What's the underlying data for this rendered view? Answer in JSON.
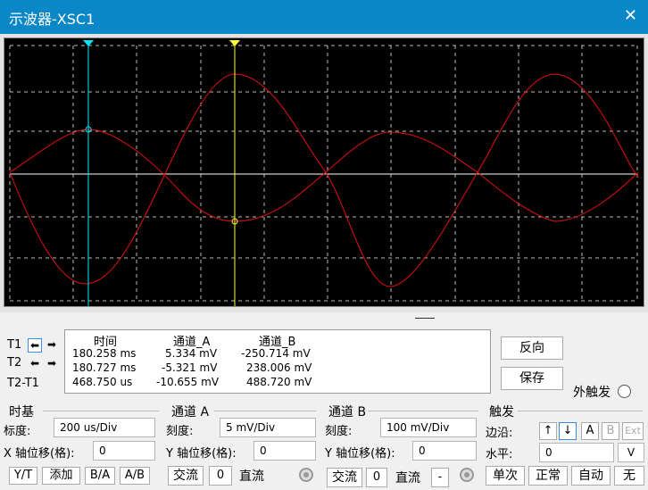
{
  "window": {
    "title": "示波器-XSC1",
    "close_glyph": "✕"
  },
  "cursors": {
    "t1_label": "T1",
    "t2_label": "T2",
    "diff_label": "T2-T1",
    "t1_color": "#00e5ff",
    "t2_color": "#ffff33"
  },
  "readout": {
    "headers": {
      "time": "时间",
      "ch_a": "通道_A",
      "ch_b": "通道_B"
    },
    "rows": [
      {
        "time": "180.258 ms",
        "ch_a": "5.334 mV",
        "ch_b": "-250.714 mV"
      },
      {
        "time": "180.727 ms",
        "ch_a": "-5.321 mV",
        "ch_b": "238.006 mV"
      },
      {
        "time": "468.750 us",
        "ch_a": "-10.655 mV",
        "ch_b": "488.720 mV"
      }
    ]
  },
  "actions": {
    "reverse": "反向",
    "save": "保存",
    "ext_trigger": "外触发"
  },
  "timebase": {
    "title": "时基",
    "scale_label": "标度:",
    "scale_value": "200 us/Div",
    "xpos_label": "X 轴位移(格):",
    "xpos_value": "0",
    "buttons": [
      "Y/T",
      "添加",
      "B/A",
      "A/B"
    ]
  },
  "channel_a": {
    "title": "通道 A",
    "scale_label": "刻度:",
    "scale_value": "5 mV/Div",
    "ypos_label": "Y 轴位移(格):",
    "ypos_value": "0",
    "ac": "交流",
    "zero": "0",
    "dc": "直流"
  },
  "channel_b": {
    "title": "通道 B",
    "scale_label": "刻度:",
    "scale_value": "100 mV/Div",
    "ypos_label": "Y 轴位移(格):",
    "ypos_value": "0",
    "ac": "交流",
    "zero": "0",
    "dc": "直流",
    "minus": "-"
  },
  "trigger": {
    "title": "触发",
    "edge_label": "边沿:",
    "edge_rise": "↑",
    "edge_fall": "↓",
    "src_a": "A",
    "src_b": "B",
    "src_ext": "Ext",
    "level_label": "水平:",
    "level_value": "0",
    "level_unit": "V",
    "modes": [
      "单次",
      "正常",
      "自动",
      "无"
    ]
  },
  "colors": {
    "trace": "#e01010",
    "screen": "#000000",
    "titlebar": "#0a87c6"
  }
}
